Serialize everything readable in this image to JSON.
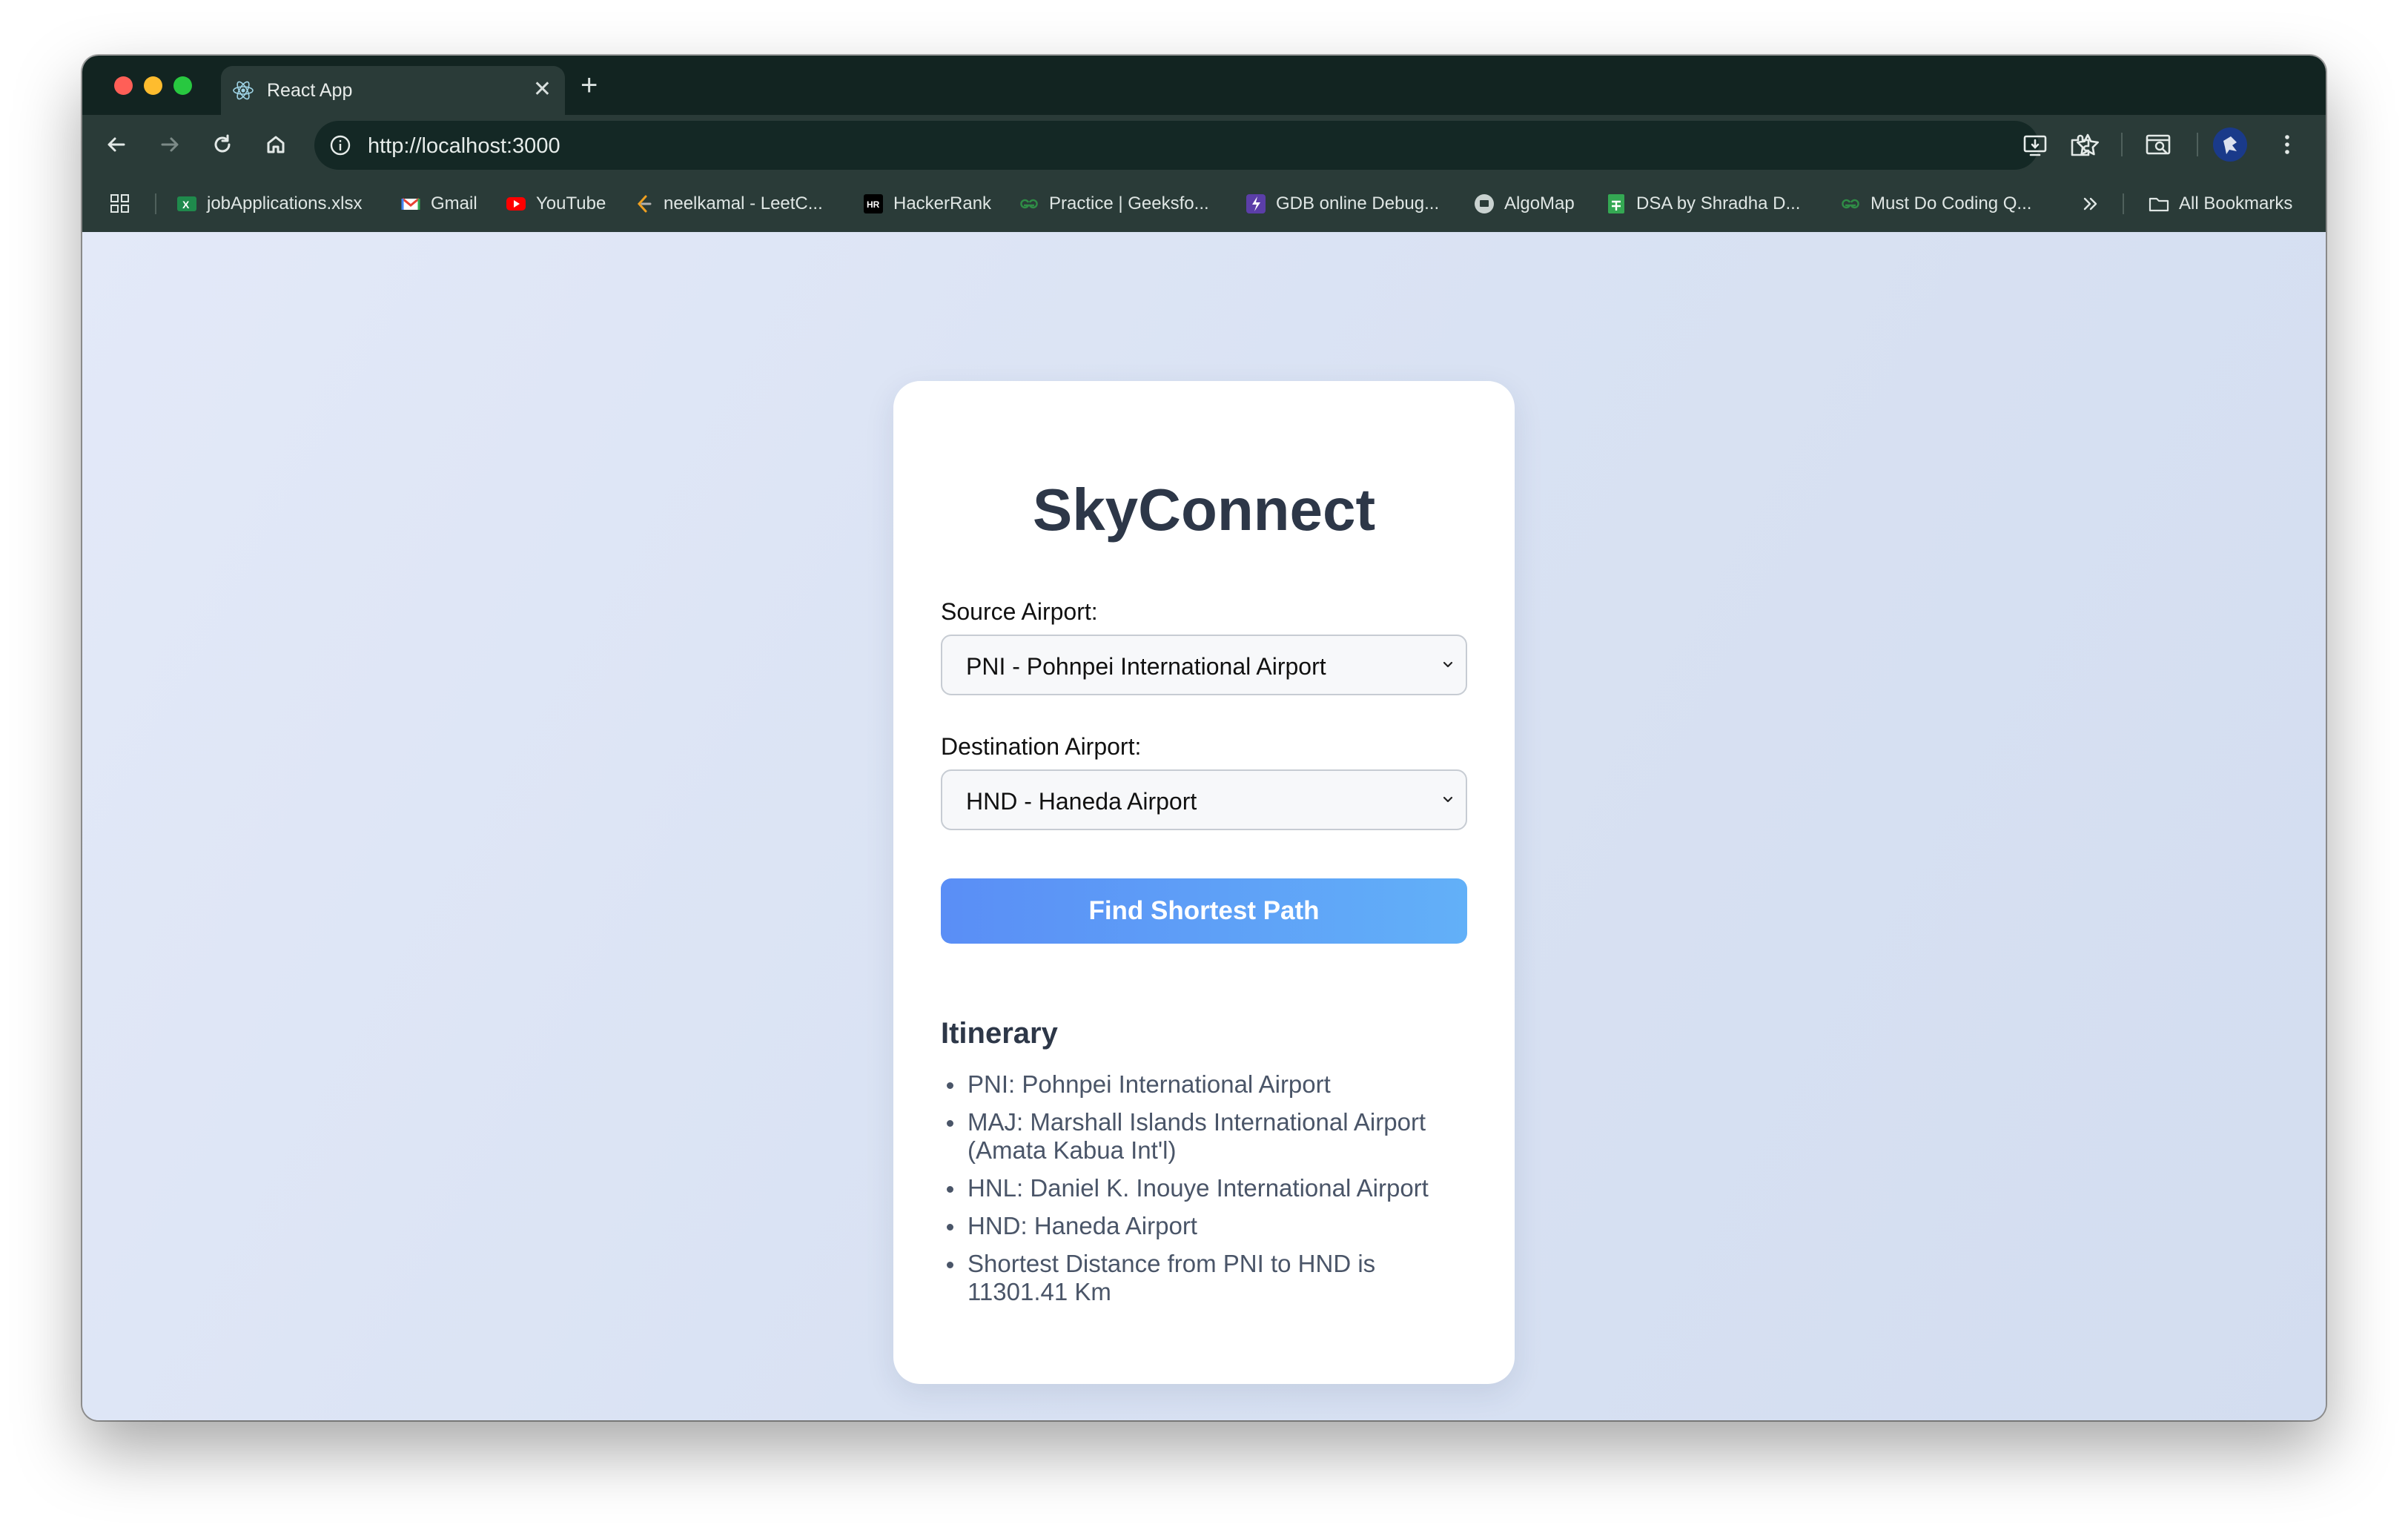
{
  "browser": {
    "tab_title": "React App",
    "url": "http://localhost:3000",
    "bookmarks": [
      {
        "label": "jobApplications.xlsx",
        "icon": "excel-icon"
      },
      {
        "label": "Gmail",
        "icon": "gmail-icon"
      },
      {
        "label": "YouTube",
        "icon": "youtube-icon"
      },
      {
        "label": "neelkamal - LeetC...",
        "icon": "leetcode-icon"
      },
      {
        "label": "HackerRank",
        "icon": "hackerrank-icon"
      },
      {
        "label": "Practice | Geeksfo...",
        "icon": "geeksforgeeks-icon"
      },
      {
        "label": "GDB online Debug...",
        "icon": "gdb-icon"
      },
      {
        "label": "AlgoMap",
        "icon": "algomap-icon"
      },
      {
        "label": "DSA by Shradha D...",
        "icon": "sheets-icon"
      },
      {
        "label": "Must Do Coding Q...",
        "icon": "geeksforgeeks-icon"
      }
    ],
    "all_bookmarks": "All Bookmarks",
    "colors": {
      "frame": "#122421",
      "toolbar": "#2a3b38",
      "omnibox": "#142825"
    }
  },
  "app": {
    "title": "SkyConnect",
    "source_label": "Source Airport:",
    "source_value": "PNI - Pohnpei International Airport",
    "destination_label": "Destination Airport:",
    "destination_value": "HND - Haneda Airport",
    "button_label": "Find Shortest Path",
    "itinerary_title": "Itinerary",
    "itinerary": [
      "PNI: Pohnpei International Airport",
      "MAJ: Marshall Islands International Airport (Amata Kabua Int'l)",
      "HNL: Daniel K. Inouye International Airport",
      "HND: Haneda Airport",
      "Shortest Distance from PNI to HND is 11301.41 Km"
    ],
    "colors": {
      "title": "#2d3748",
      "button_start": "#5a8ef6",
      "button_end": "#62b0f8",
      "list_text": "#4a5568"
    }
  }
}
